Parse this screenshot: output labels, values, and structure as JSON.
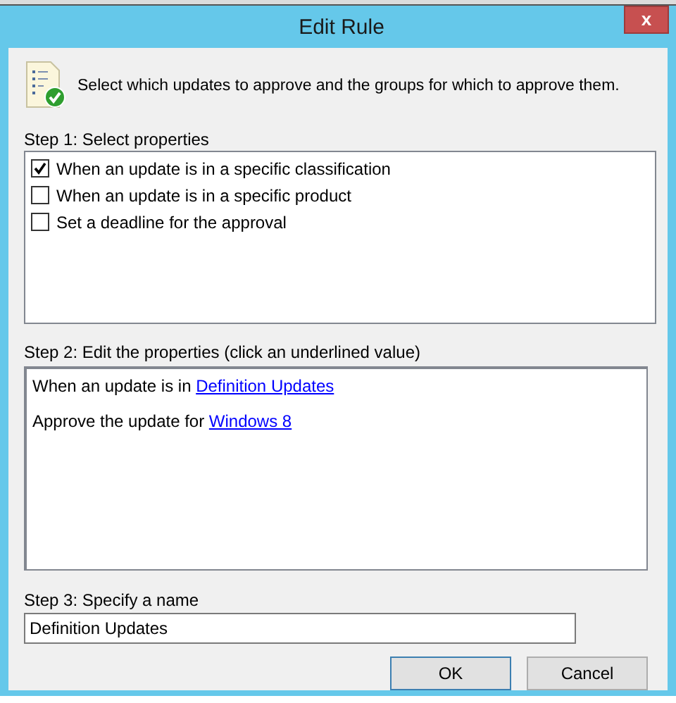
{
  "window": {
    "title": "Edit Rule",
    "close": "x"
  },
  "header": {
    "text": "Select which updates to approve and the groups for which to approve them."
  },
  "step1": {
    "label": "Step 1: Select properties",
    "properties": [
      {
        "label": "When an update is in a specific classification",
        "checked": true
      },
      {
        "label": "When an update is in a specific product",
        "checked": false
      },
      {
        "label": "Set a deadline for the approval",
        "checked": false
      }
    ]
  },
  "step2": {
    "label": "Step 2: Edit the properties (click an underlined value)",
    "lines": [
      {
        "text": "When an update is in ",
        "link": "Definition Updates"
      },
      {
        "text": "Approve the update for ",
        "link": "Windows 8"
      }
    ]
  },
  "step3": {
    "label": "Step 3: Specify a name",
    "value": "Definition Updates"
  },
  "buttons": [
    {
      "label": "OK",
      "default": true
    },
    {
      "label": "Cancel",
      "default": false
    }
  ]
}
